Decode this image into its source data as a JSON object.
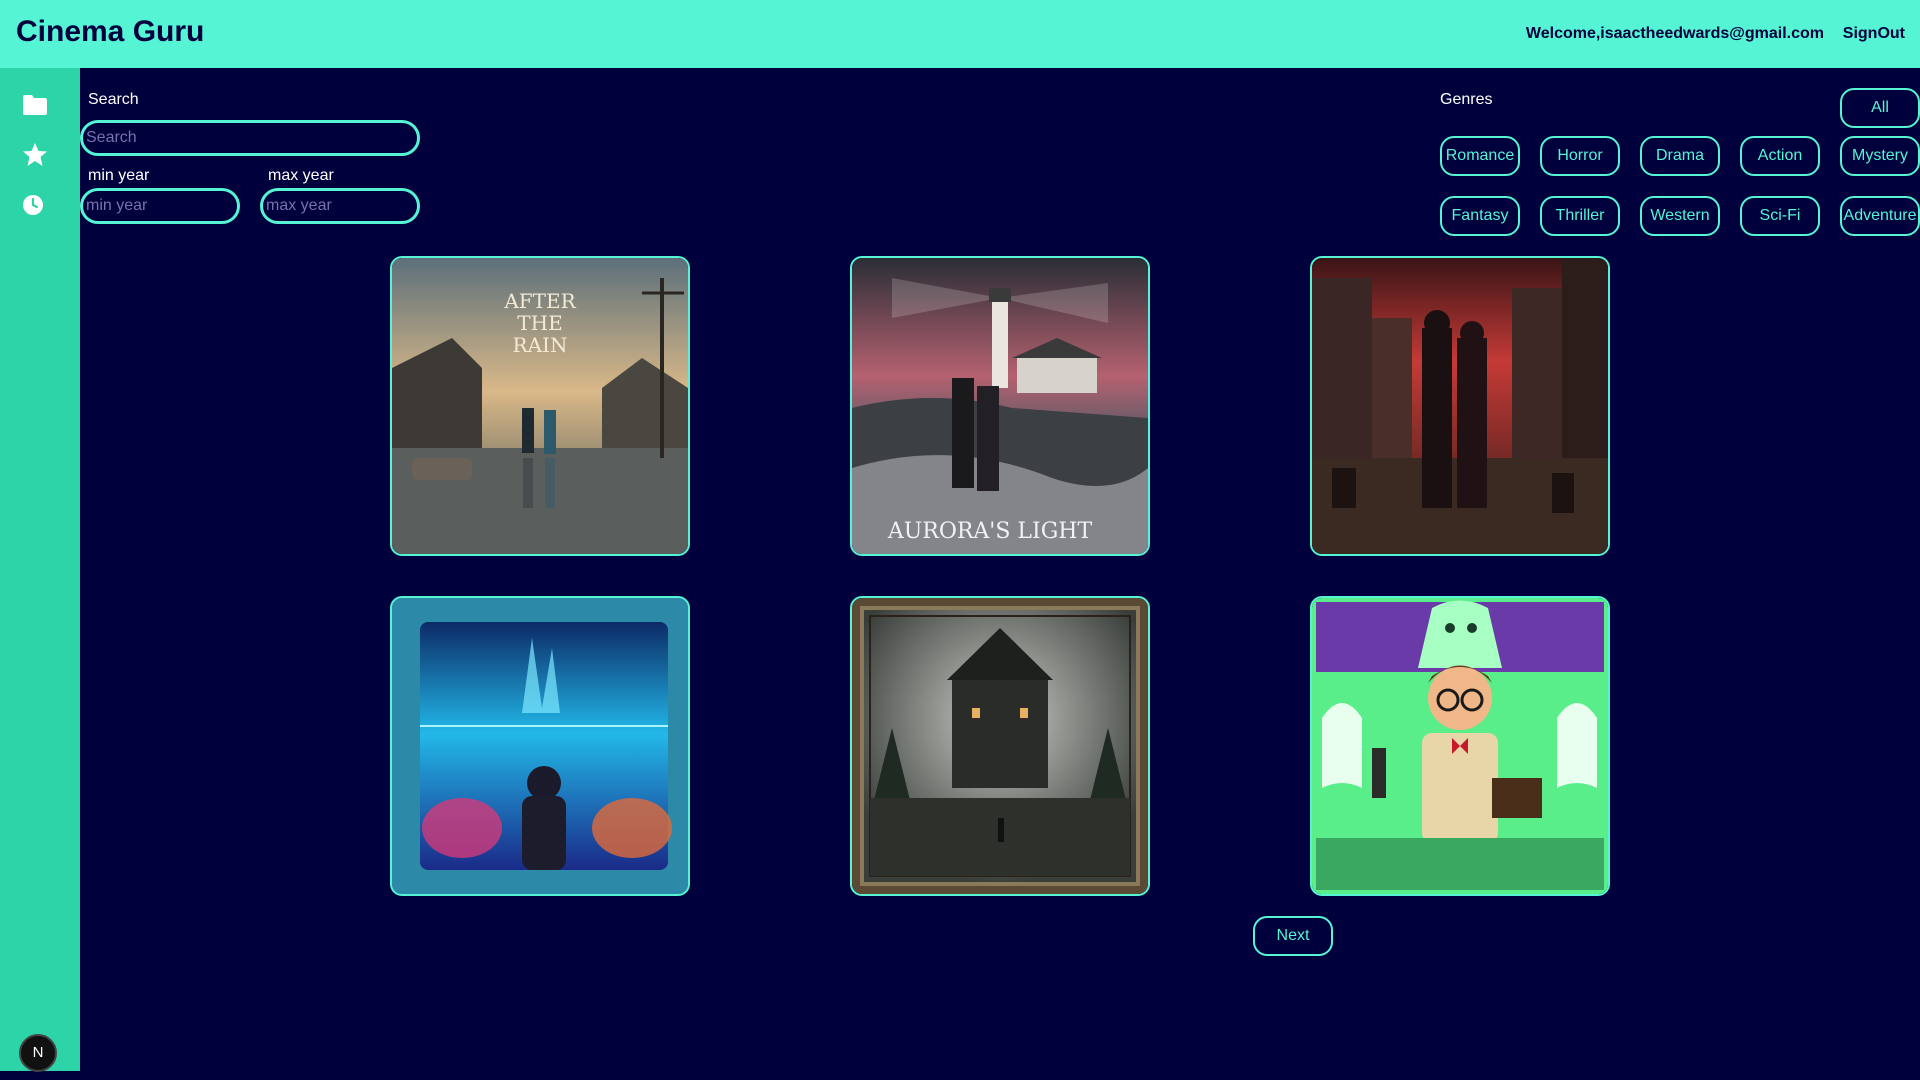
{
  "header": {
    "title": "Cinema Guru",
    "welcome": "Welcome,isaactheedwards@gmail.com",
    "signout": "SignOut"
  },
  "sidebar": {
    "icons": [
      "folder-icon",
      "star-icon",
      "clock-icon"
    ],
    "badge": "N"
  },
  "filters": {
    "search_label": "Search",
    "search_placeholder": "Search",
    "min_year_label": "min year",
    "min_year_placeholder": "min year",
    "max_year_label": "max year",
    "max_year_placeholder": "max year",
    "genres_label": "Genres",
    "all_label": "All",
    "genres": [
      "Romance",
      "Horror",
      "Drama",
      "Action",
      "Mystery",
      "Fantasy",
      "Thriller",
      "Western",
      "Sci-Fi",
      "Adventure"
    ]
  },
  "posters": [
    {
      "text_lines": [
        "AFTER",
        "THE",
        "RAIN"
      ]
    },
    {
      "text_lines": [
        "AURORA'S LIGHT"
      ]
    },
    {
      "text_lines": []
    },
    {
      "text_lines": []
    },
    {
      "text_lines": []
    },
    {
      "text_lines": []
    }
  ],
  "pagination": {
    "next_label": "Next"
  },
  "colors": {
    "background": "#00003c",
    "accent": "#54f4d4",
    "sidebar": "#2cd4a8"
  }
}
